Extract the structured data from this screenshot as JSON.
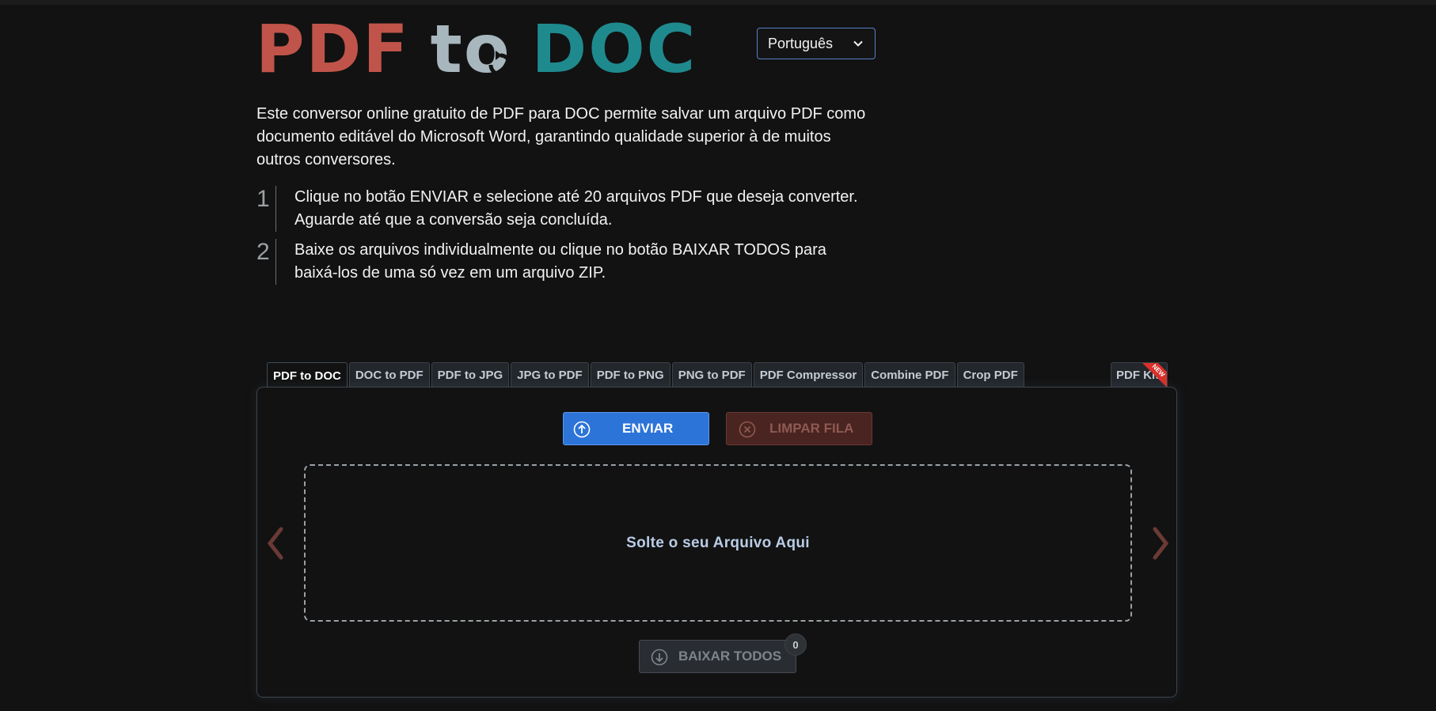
{
  "logo": {
    "part1": "PDF",
    "part2": "to",
    "part3": "DOC"
  },
  "language": {
    "selected": "Português"
  },
  "intro": "Este conversor online gratuito de PDF para DOC permite salvar um arquivo PDF como documento editável do Microsoft Word, garantindo qualidade superior à de muitos outros conversores.",
  "steps": [
    {
      "num": "1",
      "text": "Clique no botão ENVIAR e selecione até 20 arquivos PDF que deseja converter. Aguarde até que a conversão seja concluída."
    },
    {
      "num": "2",
      "text": "Baixe os arquivos individualmente ou clique no botão BAIXAR TODOS para baixá-los de uma só vez em um arquivo ZIP."
    }
  ],
  "tabs": [
    "PDF to DOC",
    "DOC to PDF",
    "PDF to JPG",
    "JPG to PDF",
    "PDF to PNG",
    "PNG to PDF",
    "PDF Compressor",
    "Combine PDF",
    "Crop PDF"
  ],
  "tab_kit": {
    "label": "PDF Kit",
    "ribbon": "NEW"
  },
  "buttons": {
    "upload": "ENVIAR",
    "clear": "LIMPAR FILA",
    "download_all": "BAIXAR TODOS",
    "download_count": "0"
  },
  "dropzone": {
    "message": "Solte o seu Arquivo Aqui"
  },
  "colors": {
    "background": "#121212",
    "logo_pdf": "#c0544a",
    "logo_to": "#a8b6bd",
    "logo_doc": "#1f8a8e",
    "upload_button": "#2c74d8",
    "clear_button": "#4a2420"
  },
  "icons": {
    "upload": "arrow-up-circle-icon",
    "clear": "x-circle-icon",
    "download": "arrow-down-circle-icon",
    "prev": "chevron-left-icon",
    "next": "chevron-right-icon",
    "language": "chevron-down-icon"
  }
}
